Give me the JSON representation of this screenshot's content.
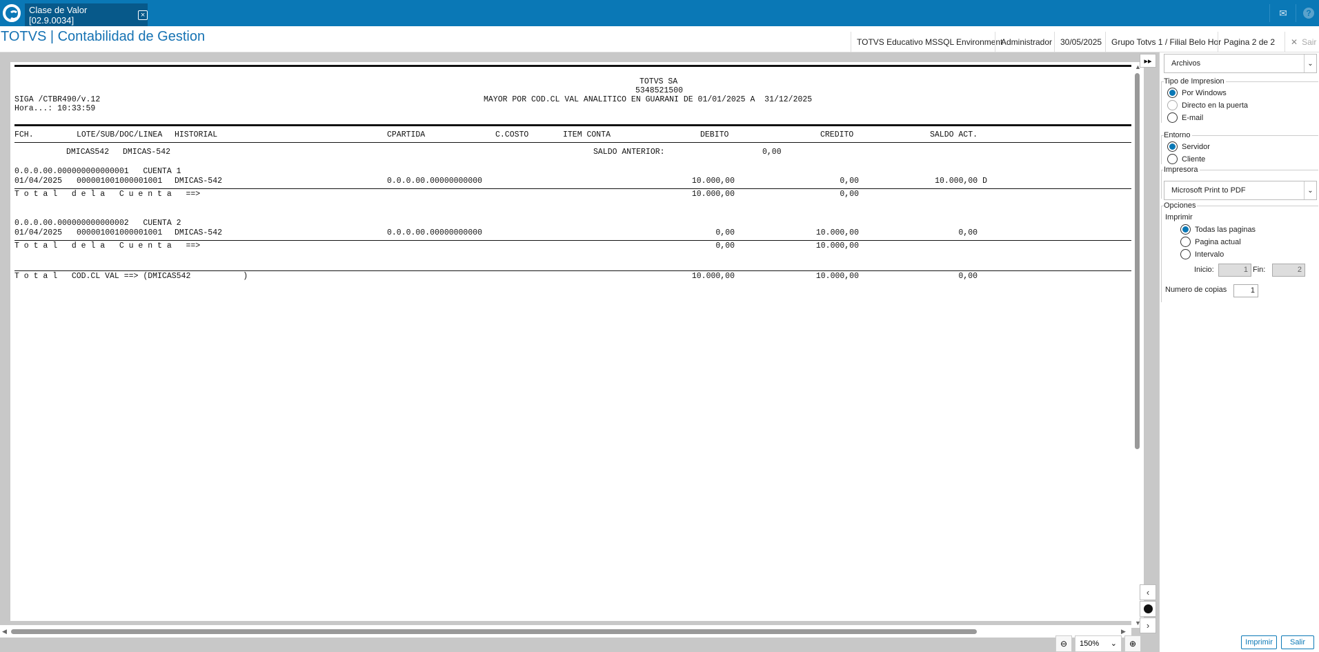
{
  "window": {
    "tab_title": "Clase de Valor [02.9.0034]"
  },
  "header": {
    "app_title": "TOTVS | Contabilidad de Gestion",
    "environment": "TOTVS Educativo MSSQL Environment",
    "user": "Administrador",
    "date": "30/05/2025",
    "company": "Grupo Totvs 1 / Filial Belo Hor",
    "page": "Pagina 2 de 2",
    "exit_label": "Sair"
  },
  "report": {
    "company": "TOTVS SA",
    "code": "5348521500",
    "program": "SIGA /CTBR490/v.12",
    "title": "MAYOR POR COD.CL VAL ANALITICO EN GUARANI DE 01/01/2025 A  31/12/2025",
    "time": "Hora...: 10:33:59",
    "columns": [
      "FCH.",
      "LOTE/SUB/DOC/LINEA",
      "HISTORIAL",
      "CPARTIDA",
      "C.COSTO",
      "ITEM CONTA",
      "DEBITO",
      "CREDITO",
      "SALDO ACT."
    ],
    "class_code": "DMICAS542",
    "class_name": "DMICAS-542",
    "previous_balance_label": "SALDO ANTERIOR:",
    "previous_balance": "0,00",
    "accounts": [
      {
        "header": "0.0.0.00.000000000000001   CUENTA 1",
        "date": "01/04/2025",
        "lote": "000001001000001001",
        "hist": "DMICAS-542",
        "cpartida": "0.0.0.00.00000000000",
        "debit": "10.000,00",
        "credit": "0,00",
        "balance": "10.000,00 D",
        "total_label": "T o t a l   d e l a   C u e n t a   ==>",
        "total_debit": "10.000,00",
        "total_credit": "0,00"
      },
      {
        "header": "0.0.0.00.000000000000002   CUENTA 2",
        "date": "01/04/2025",
        "lote": "000001001000001001",
        "hist": "DMICAS-542",
        "cpartida": "0.0.0.00.00000000000",
        "debit": "0,00",
        "credit": "10.000,00",
        "balance": "0,00",
        "total_label": "T o t a l   d e l a   C u e n t a   ==>",
        "total_debit": "0,00",
        "total_credit": "10.000,00"
      }
    ],
    "grand_total_label": "T o t a l   COD.CL VAL ==> (DMICAS542           )",
    "grand_debit": "10.000,00",
    "grand_credit": "10.000,00",
    "grand_balance": "0,00"
  },
  "zoom": "150%",
  "panel": {
    "file_select": "Archivos",
    "print_type_label": "Tipo de Impresion",
    "print_types": [
      "Por Windows",
      "Directo en la puerta",
      "E-mail"
    ],
    "environment_label": "Entorno",
    "environments": [
      "Servidor",
      "Cliente"
    ],
    "printer_label": "Impresora",
    "printer": "Microsoft Print to PDF",
    "options_label": "Opciones",
    "print_label": "Imprimir",
    "print_options": [
      "Todas las paginas",
      "Pagina actual",
      "Intervalo"
    ],
    "start_label": "Inicio:",
    "start_value": "1",
    "end_label": "Fin:",
    "end_value": "2",
    "copies_label": "Numero de copias",
    "copies_value": "1",
    "print_button": "Imprimir",
    "exit_button": "Salir"
  },
  "icons": {
    "logo": "totvs-logo-icon",
    "mail": "mail-icon",
    "help": "help-icon"
  }
}
